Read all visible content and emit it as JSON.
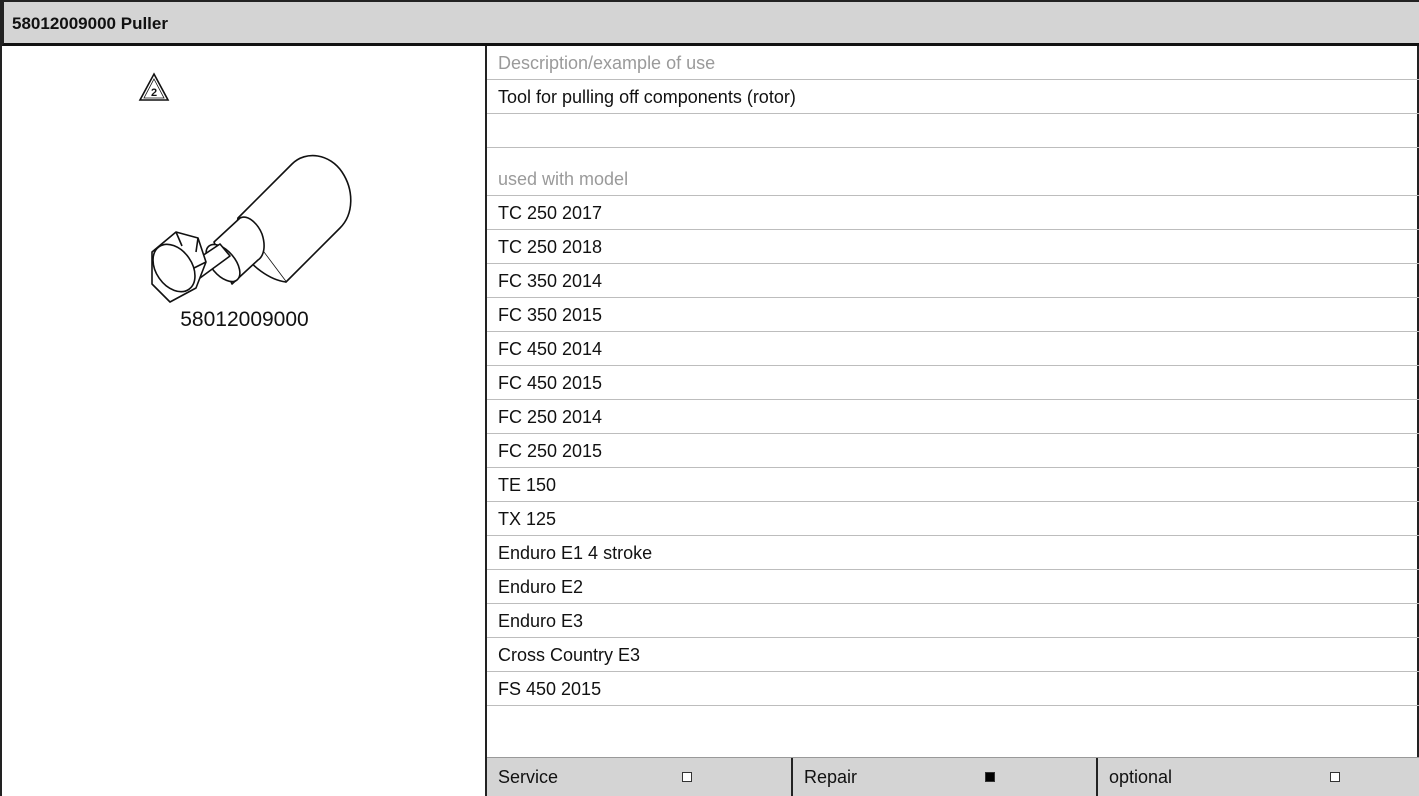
{
  "header": {
    "title": "58012009000 Puller"
  },
  "tool": {
    "number": "58012009000",
    "warning_label": "2",
    "warning_icon": "warning-triangle-icon",
    "drawing_icon": "puller-tool-icon"
  },
  "details": {
    "description_label": "Description/example of use",
    "description": "Tool for pulling off components (rotor)",
    "models_label": "used with model",
    "models": [
      "TC 250 2017",
      "TC 250 2018",
      "FC 350 2014",
      "FC 350 2015",
      "FC 450 2014",
      "FC 450 2015",
      "FC 250 2014",
      "FC 250 2015",
      "TE 150",
      "TX 125",
      "Enduro E1 4 stroke",
      "Enduro E2",
      "Enduro E3",
      "Cross Country E3",
      "FS 450 2015"
    ]
  },
  "footer": {
    "service_label": "Service",
    "service_checked": false,
    "repair_label": "Repair",
    "repair_checked": true,
    "optional_label": "optional",
    "optional_checked": false
  },
  "colors": {
    "header_bg": "#d4d4d4",
    "label_text": "#9a9a9a",
    "border": "#222222"
  }
}
